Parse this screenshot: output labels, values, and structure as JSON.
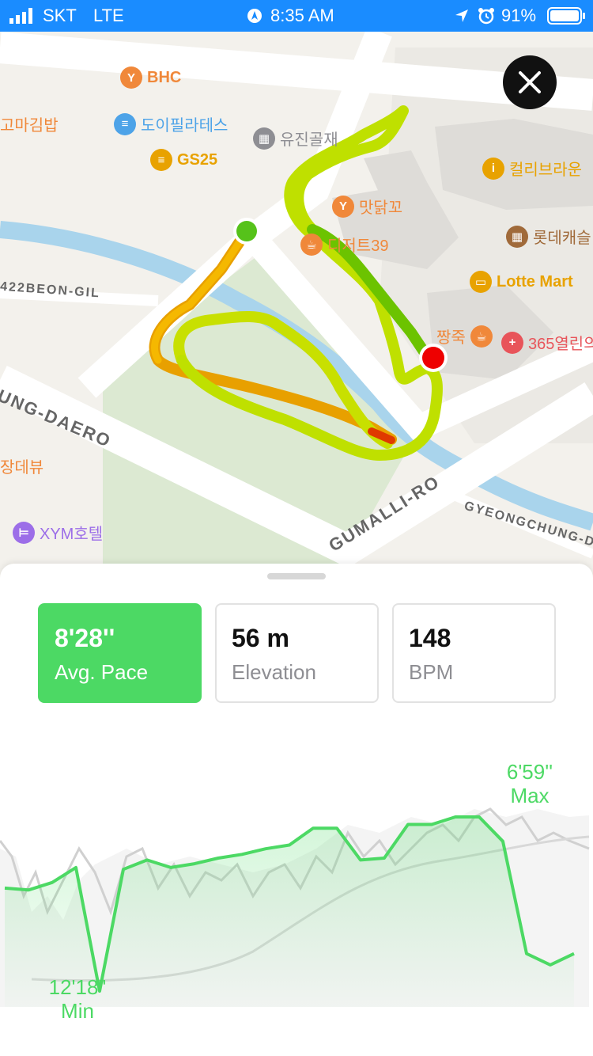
{
  "status_bar": {
    "carrier": "SKT",
    "network": "LTE",
    "time": "8:35 AM",
    "battery": "91%"
  },
  "map": {
    "pois": [
      {
        "name": "BHC",
        "icon": "restaurant-icon",
        "color": "#f0883a"
      },
      {
        "name": "고마김밥",
        "icon": "none",
        "color": "#f0883a"
      },
      {
        "name": "도이필라테스",
        "icon": "dumbbell-icon",
        "color": "#4da3e8"
      },
      {
        "name": "유진골재",
        "icon": "building-icon",
        "color": "#8e8e93"
      },
      {
        "name": "GS25",
        "icon": "store-icon",
        "color": "#e8a200"
      },
      {
        "name": "컬리브라운",
        "icon": "shopping-icon",
        "color": "#e8a200"
      },
      {
        "name": "맛닭꼬",
        "icon": "restaurant-icon",
        "color": "#f0883a"
      },
      {
        "name": "디저트39",
        "icon": "cafe-icon",
        "color": "#f0883a"
      },
      {
        "name": "롯데캐슬",
        "icon": "apartment-icon",
        "color": "#a06a3a"
      },
      {
        "name": "Lotte Mart",
        "icon": "bag-icon",
        "color": "#e8a200"
      },
      {
        "name": "짱죽",
        "icon": "cafe-icon",
        "color": "#f0883a"
      },
      {
        "name": "365열린의",
        "icon": "pharmacy-icon",
        "color": "#e8545a"
      },
      {
        "name": "장데뷰",
        "icon": "none",
        "color": "#f0883a"
      },
      {
        "name": "XYM호텔",
        "icon": "bed-icon",
        "color": "#9c6ee8"
      }
    ],
    "roads": {
      "beon_gil": "422BEON-GIL",
      "daero": "UNG-DAERO",
      "gumalli": "GUMALLI-RO",
      "gyeongchung": "GYEONGCHUNG-D"
    }
  },
  "stats": [
    {
      "value": "8'28''",
      "label": "Avg. Pace",
      "active": true
    },
    {
      "value": "56 m",
      "label": "Elevation",
      "active": false
    },
    {
      "value": "148",
      "label": "BPM",
      "active": false
    }
  ],
  "chart_data": {
    "type": "line",
    "series": [
      {
        "values": [
          6.5,
          6.4,
          6.8,
          7.6,
          1.0,
          7.5,
          8.0,
          7.6,
          7.8,
          8.1,
          8.3,
          8.6,
          8.8,
          9.7,
          9.7,
          8.0,
          8.1,
          9.9,
          9.9,
          10.3,
          10.3,
          9.0,
          3.0,
          2.4,
          3.0
        ]
      }
    ],
    "color": "#4cd964",
    "max_label": "6'59''",
    "max_caption": "Max",
    "min_label": "12'18''",
    "min_caption": "Min"
  }
}
